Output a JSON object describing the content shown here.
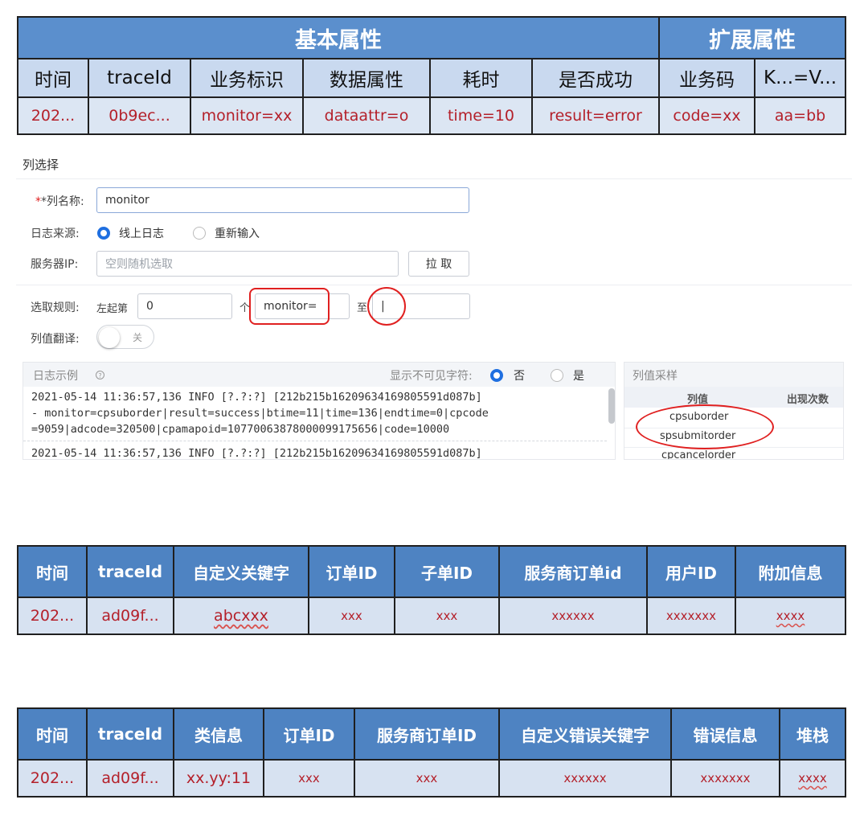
{
  "table1": {
    "group_basic": "基本属性",
    "group_ext": "扩展属性",
    "headers": [
      "时间",
      "traceId",
      "业务标识",
      "数据属性",
      "耗时",
      "是否成功",
      "业务码",
      "K...=V..."
    ],
    "values": [
      "202...",
      "0b9ec...",
      "monitor=xx",
      "dataattr=o",
      "time=10",
      "result=error",
      "code=xx",
      "aa=bb"
    ]
  },
  "form": {
    "section_title": "列选择",
    "col_name_label": "*列名称:",
    "col_name_value": "monitor",
    "log_source_label": "日志来源:",
    "log_source_opt1": "线上日志",
    "log_source_opt2": "重新输入",
    "server_ip_label": "服务器IP:",
    "server_ip_placeholder": "空则随机选取",
    "fetch_button": "拉 取",
    "rule_label": "选取规则:",
    "rule_from_left": "左起第",
    "rule_index": "0",
    "rule_unit": "个",
    "rule_start": "monitor=",
    "rule_to": "至",
    "rule_end": "|",
    "translate_label": "列值翻译:",
    "translate_toggle": "关",
    "log_example_title": "日志示例",
    "show_invisible_label": "显示不可见字符:",
    "show_invisible_no": "否",
    "show_invisible_yes": "是",
    "log_lines": [
      "2021-05-14 11:36:57,136 INFO [?.?:?] [212b215b16209634169805591d087b]",
      "- monitor=cpsuborder|result=success|btime=11|time=136|endtime=0|cpcode",
      "=9059|adcode=320500|cpamapoid=10770063878000099175656|code=10000",
      "2021-05-14 11:36:57,136 INFO [?.?:?] [212b215b16209634169805591d087b]"
    ],
    "sample_title": "列值采样",
    "sample_col_value": "列值",
    "sample_col_count": "出现次数",
    "sample_values": [
      "cpsuborder",
      "spsubmitorder",
      "cpcancelorder"
    ]
  },
  "table2": {
    "headers": [
      "时间",
      "traceId",
      "自定义关键字",
      "订单ID",
      "子单ID",
      "服务商订单id",
      "用户ID",
      "附加信息"
    ],
    "values": [
      "202...",
      "ad09f...",
      "abcxxx",
      "xxx",
      "xxx",
      "xxxxxx",
      "xxxxxxx",
      "xxxx"
    ]
  },
  "table3": {
    "headers": [
      "时间",
      "traceId",
      "类信息",
      "订单ID",
      "服务商订单ID",
      "自定义错误关键字",
      "错误信息",
      "堆栈"
    ],
    "values": [
      "202...",
      "ad09f...",
      "xx.yy:11",
      "xxx",
      "xxx",
      "xxxxxx",
      "xxxxxxx",
      "xxxx"
    ]
  },
  "colors": {
    "header_blue": "#5b8fcd",
    "accent_red": "#b4202a",
    "radio_blue": "#1f6fe0"
  }
}
